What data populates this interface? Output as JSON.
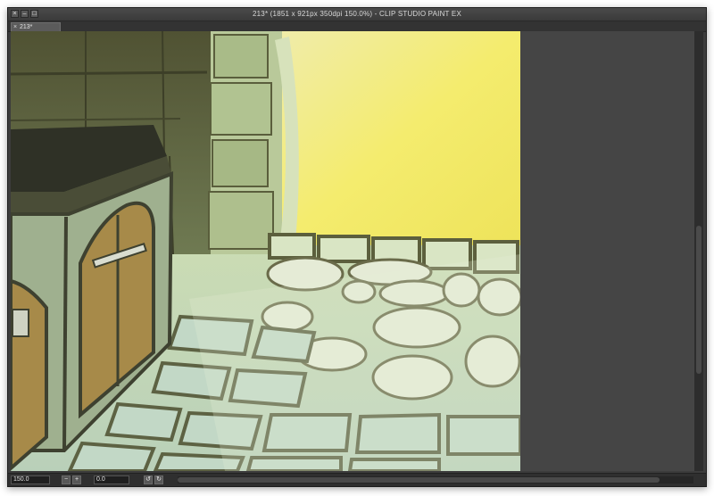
{
  "window": {
    "title": "213* (1851 x 921px 350dpi 150.0%)  - CLIP STUDIO PAINT EX"
  },
  "tabs": [
    {
      "label": "213*",
      "close_glyph": "×"
    }
  ],
  "window_buttons": {
    "close_glyph": "×",
    "minimize_glyph": "–",
    "maximize_glyph": "□"
  },
  "statusbar": {
    "zoom_value": "150.0",
    "rotation_value": "0.0",
    "zoom_out_glyph": "−",
    "zoom_in_glyph": "+",
    "rotate_left_glyph": "↺",
    "rotate_right_glyph": "↻"
  },
  "colors": {
    "window_bg": "#3c3c3c",
    "canvas_bg": "#454545",
    "art_light_yellow": "#f4ec6e",
    "art_stone_green": "#c9dcbc",
    "art_dark_olive": "#4f5136",
    "art_door_ochre": "#a78a49"
  }
}
